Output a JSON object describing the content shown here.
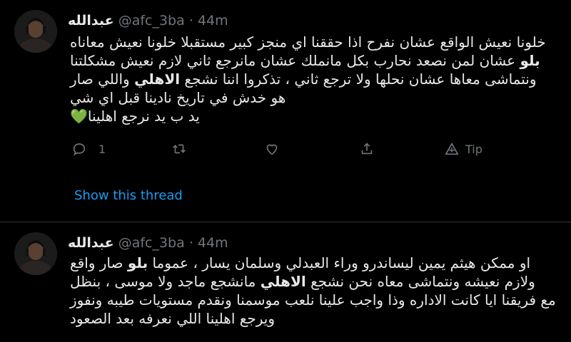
{
  "tweets": [
    {
      "author": {
        "name": "عبدالله",
        "handle": "@afc_3ba",
        "dot": "·",
        "time": "44m"
      },
      "lines": [
        [
          {
            "t": "خلونا نعيش الواقع عشان نفرح اذا حققنا اي منجز كبير مستقبلا خلونا نعيش معاناه"
          }
        ],
        [
          {
            "t": "بلو",
            "b": true
          },
          {
            "t": " عشان لمن نصعد نحارب بكل مانملك عشان مانرجع ثاني لازم نعيش مشكلتنا"
          }
        ],
        [
          {
            "t": "ونتماشى معاها عشان نحلها ولا ترجع ثاني ، تذكروا اننا نشجع "
          },
          {
            "t": "الاهلي",
            "b": true
          },
          {
            "t": " واللي صار"
          }
        ],
        [
          {
            "t": "هو خدش في تاريخ نادينا قبل اي شي"
          }
        ],
        [
          {
            "t": "يد ب يد نرجع اهلينا"
          },
          {
            "t": "💚",
            "heart": true
          }
        ]
      ],
      "actions": {
        "reply_count": "1",
        "tip_label": "Tip"
      },
      "show_thread": "Show this thread"
    },
    {
      "author": {
        "name": "عبدالله",
        "handle": "@afc_3ba",
        "dot": "·",
        "time": "44m"
      },
      "lines": [
        [
          {
            "t": "او ممكن هيثم يمين ليساندرو وراء العبدلي وسلمان يسار ، عموما "
          },
          {
            "t": "بلو",
            "b": true
          },
          {
            "t": " صار واقع"
          }
        ],
        [
          {
            "t": "ولازم نعيشه ونتماشى معاه نحن نشجع "
          },
          {
            "t": "الاهلي",
            "b": true
          },
          {
            "t": " مانشجع ماجد ولا موسى ، بنظل"
          }
        ],
        [
          {
            "t": "مع فريقنا ايا كانت الاداره وذا واجب علينا نلعب موسمنا ونقدم مستويات طيبه ونفوز"
          }
        ],
        [
          {
            "t": "ويرجع اهلينا اللي نعرفه بعد الصعود"
          }
        ]
      ]
    }
  ],
  "colors": {
    "background": "#000000",
    "link": "#1d9bf0",
    "muted": "#71767b",
    "divider": "#2f3336"
  },
  "icons": [
    "reply-icon",
    "retweet-icon",
    "like-icon",
    "share-icon",
    "tip-icon"
  ]
}
